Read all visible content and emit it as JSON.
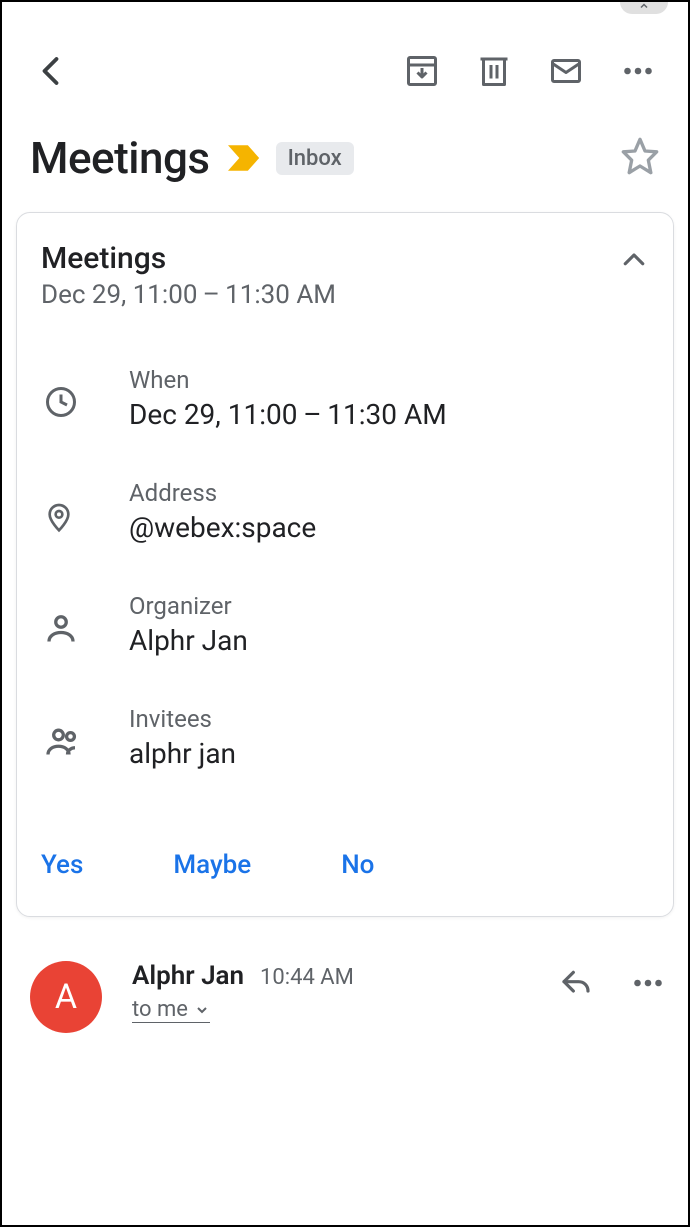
{
  "subject": "Meetings",
  "label": "Inbox",
  "event": {
    "title": "Meetings",
    "summary_time": "Dec 29, 11:00 – 11:30 AM",
    "when_label": "When",
    "when_value": "Dec 29, 11:00 – 11:30 AM",
    "address_label": "Address",
    "address_value": "@webex:space",
    "organizer_label": "Organizer",
    "organizer_value": "Alphr Jan",
    "invitees_label": "Invitees",
    "invitees_value": "alphr jan"
  },
  "rsvp": {
    "yes": "Yes",
    "maybe": "Maybe",
    "no": "No"
  },
  "sender": {
    "avatar_initial": "A",
    "name": "Alphr Jan",
    "time": "10:44 AM",
    "to": "to me"
  }
}
